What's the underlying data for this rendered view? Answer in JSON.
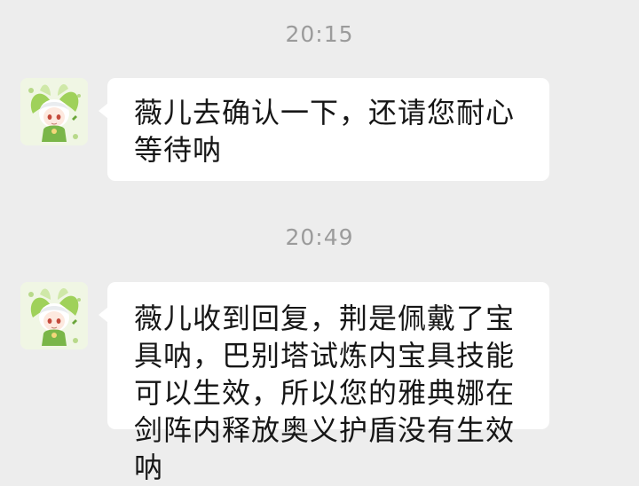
{
  "chat": {
    "messages": [
      {
        "timestamp": "20:15",
        "avatar_icon": "chibi-character-avatar-icon",
        "text": "薇儿去确认一下，还请您耐心等待呐"
      },
      {
        "timestamp": "20:49",
        "avatar_icon": "chibi-character-avatar-icon",
        "text": "薇儿收到回复，荆是佩戴了宝具呐，巴别塔试炼内宝具技能可以生效，所以您的雅典娜在剑阵内释放奥义护盾没有生效呐"
      }
    ]
  },
  "colors": {
    "background": "#ededed",
    "bubble": "#ffffff",
    "timestamp": "#9b9b9b",
    "text": "#161616",
    "avatar_accent": "#8cc63f"
  }
}
